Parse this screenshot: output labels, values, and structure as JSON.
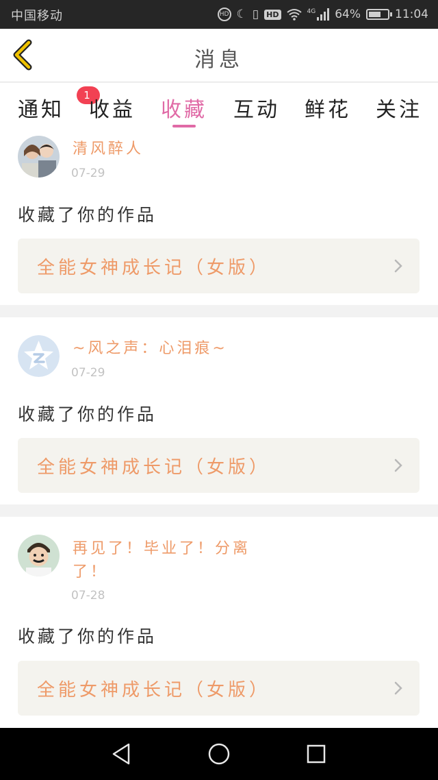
{
  "status_bar": {
    "carrier": "中国移动",
    "network": "4G",
    "battery": "64%",
    "battery_level": 0.64,
    "time": "11:04",
    "icons": [
      "hd-call-icon",
      "moon-icon",
      "vibrate-icon",
      "hd-icon",
      "wifi-icon",
      "signal-icon",
      "battery-icon"
    ]
  },
  "header": {
    "title": "消息",
    "back_icon": "chevron-left-icon"
  },
  "tabs": {
    "items": [
      {
        "label": "通知",
        "badge": "1"
      },
      {
        "label": "收益"
      },
      {
        "label": "收藏",
        "active": true
      },
      {
        "label": "互动"
      },
      {
        "label": "鲜花"
      },
      {
        "label": "关注"
      }
    ]
  },
  "feed": [
    {
      "user": "清风醉人",
      "date": "07-29",
      "message": "收藏了你的作品",
      "work": "全能女神成长记（女版）"
    },
    {
      "user": "~风之声：心泪痕~",
      "date": "07-29",
      "message": "收藏了你的作品",
      "work": "全能女神成长记（女版）"
    },
    {
      "user_line1": "再见了！毕业了！分离",
      "user_line2": "了！",
      "date": "07-28",
      "message": "收藏了你的作品",
      "work": "全能女神成长记（女版）"
    }
  ],
  "colors": {
    "accent": "#e06aa6",
    "username": "#ee9a68",
    "badge": "#f24153",
    "work_bg": "#f4f3ee"
  },
  "nav_icons": [
    "back-triangle-icon",
    "home-circle-icon",
    "recents-square-icon"
  ]
}
